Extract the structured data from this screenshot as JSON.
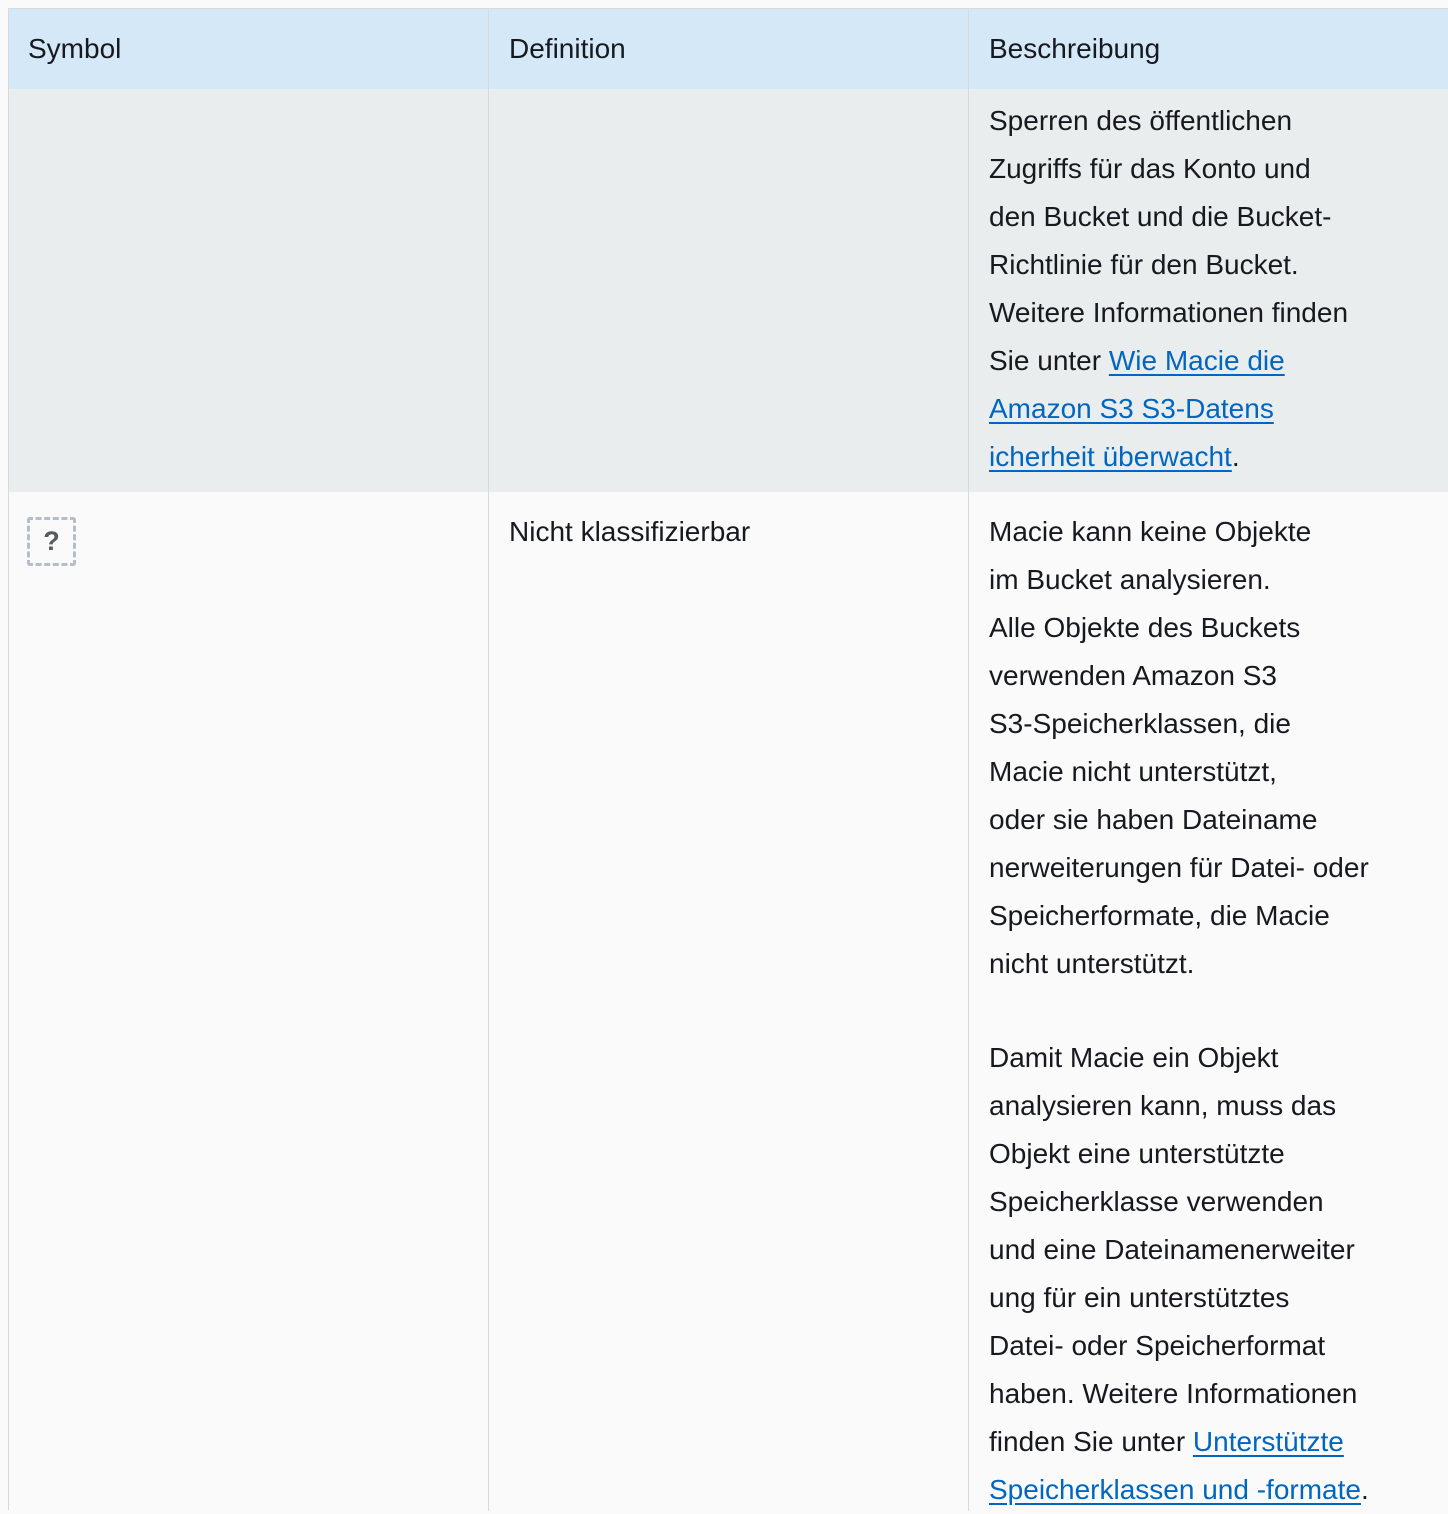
{
  "table": {
    "headers": {
      "symbol": "Symbol",
      "definition": "Definition",
      "description": "Beschreibung"
    },
    "rows": [
      {
        "symbol_icon": null,
        "definition": "",
        "description": {
          "lines": [
            "Sperren des öffentlichen",
            "Zugriffs für das Konto und",
            "den Bucket und die Bucket-",
            "Richtlinie für den Bucket.",
            "Weitere Informationen finden"
          ],
          "link_prefix": "Sie unter ",
          "link_lines": [
            "Wie Macie die",
            "Amazon S3 S3-Datens",
            "icherheit überwacht"
          ],
          "link_suffix": "."
        }
      },
      {
        "symbol_icon": "unclassifiable-icon",
        "symbol_glyph": "?",
        "definition": "Nicht klassifizierbar",
        "description": {
          "paragraph1": [
            "Macie kann keine Objekte",
            "im Bucket analysieren.",
            "Alle Objekte des Buckets",
            "verwenden Amazon S3",
            "S3-Speicherklassen, die",
            "Macie nicht unterstützt,",
            "oder sie haben Dateiname",
            "nerweiterungen für Datei- oder",
            "Speicherformate, die Macie",
            "nicht unterstützt."
          ],
          "paragraph2": [
            "Damit Macie ein Objekt",
            "analysieren kann, muss das",
            "Objekt eine unterstützte",
            "Speicherklasse verwenden",
            "und eine Dateinamenerweiter",
            "ung für ein unterstütztes",
            "Datei- oder Speicherformat",
            "haben. Weitere Informationen"
          ],
          "link_prefix": "finden Sie unter ",
          "link_lines": [
            "Unterstützte",
            "Speicherklassen und -formate"
          ],
          "link_suffix": "."
        }
      }
    ]
  },
  "colors": {
    "header_bg": "#d4e8f8",
    "shaded_row_bg": "#eaeded",
    "row_bg": "#fafafa",
    "link": "#0066c0",
    "text": "#16191f"
  }
}
